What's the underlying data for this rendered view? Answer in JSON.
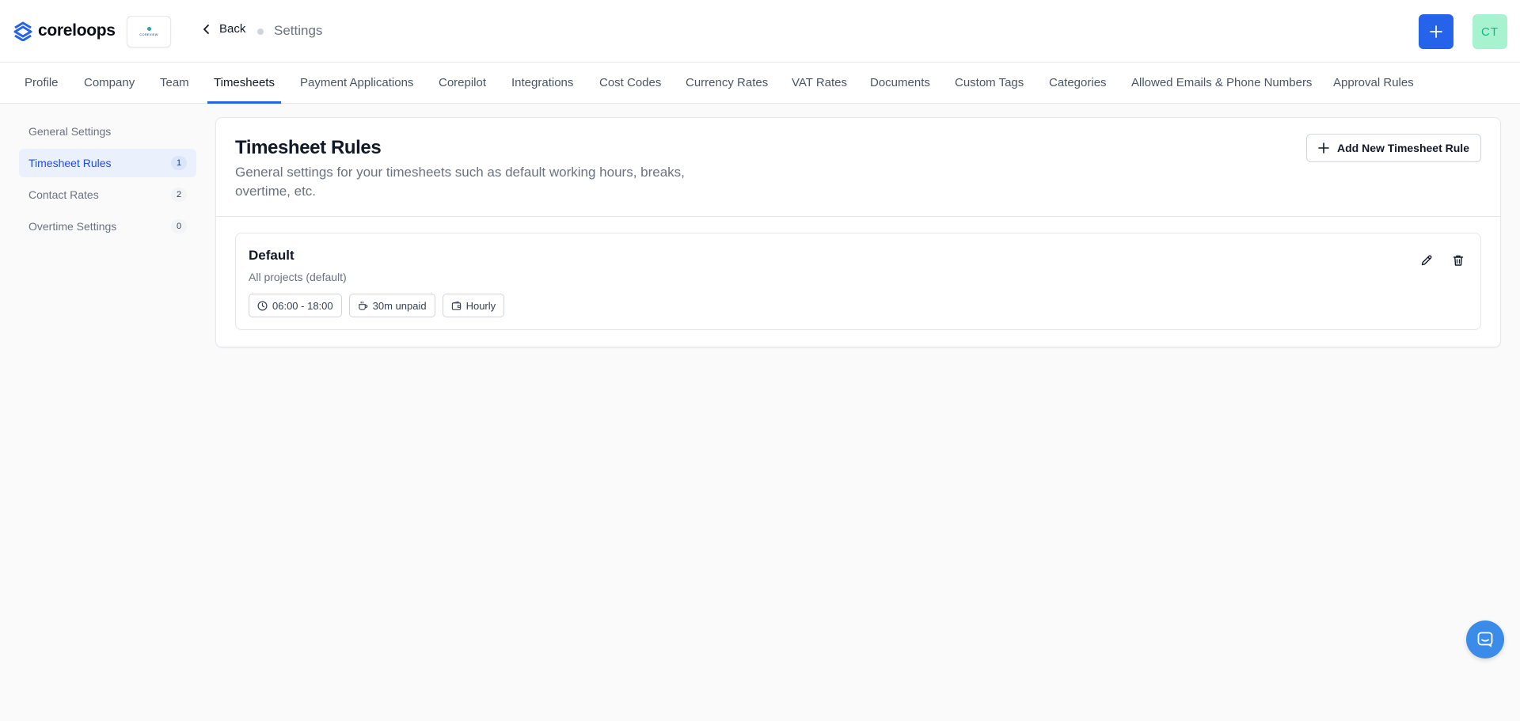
{
  "app": {
    "brand_name": "coreloops",
    "org_logo_text": "COREVIEW"
  },
  "header": {
    "back_label": "Back",
    "breadcrumb": "Settings",
    "add_icon": "plus-icon",
    "avatar_initials": "CT"
  },
  "tabs": [
    {
      "label": "Profile",
      "active": false
    },
    {
      "label": "Company",
      "active": false
    },
    {
      "label": "Team",
      "active": false
    },
    {
      "label": "Timesheets",
      "active": true
    },
    {
      "label": "Payment Applications",
      "active": false
    },
    {
      "label": "Corepilot",
      "active": false
    },
    {
      "label": "Integrations",
      "active": false
    },
    {
      "label": "Cost Codes",
      "active": false
    },
    {
      "label": "Currency Rates",
      "active": false
    },
    {
      "label": "VAT Rates",
      "active": false
    },
    {
      "label": "Documents",
      "active": false
    },
    {
      "label": "Custom Tags",
      "active": false
    },
    {
      "label": "Categories",
      "active": false
    },
    {
      "label": "Allowed Emails & Phone Numbers",
      "active": false
    },
    {
      "label": "Approval Rules",
      "active": false
    }
  ],
  "sidebar": {
    "items": [
      {
        "label": "General Settings",
        "count": ""
      },
      {
        "label": "Timesheet Rules",
        "count": "1",
        "active": true
      },
      {
        "label": "Contact Rates",
        "count": "2"
      },
      {
        "label": "Overtime Settings",
        "count": "0"
      }
    ]
  },
  "main": {
    "title": "Timesheet Rules",
    "description": "General settings for your timesheets such as default working hours, breaks, overtime, etc.",
    "add_button_label": "Add New Timesheet Rule",
    "rules": [
      {
        "name": "Default",
        "scope": "All projects (default)",
        "chips": [
          {
            "icon": "clock-icon",
            "label": "06:00 - 18:00"
          },
          {
            "icon": "coffee-icon",
            "label": "30m unpaid"
          },
          {
            "icon": "wallet-icon",
            "label": "Hourly"
          }
        ]
      }
    ]
  },
  "colors": {
    "accent": "#2563eb",
    "avatar_bg": "#a7f3d0",
    "avatar_fg": "#10b981",
    "active_sidebar_bg": "#eaf1fd",
    "chat_bubble": "#3b8be8"
  }
}
